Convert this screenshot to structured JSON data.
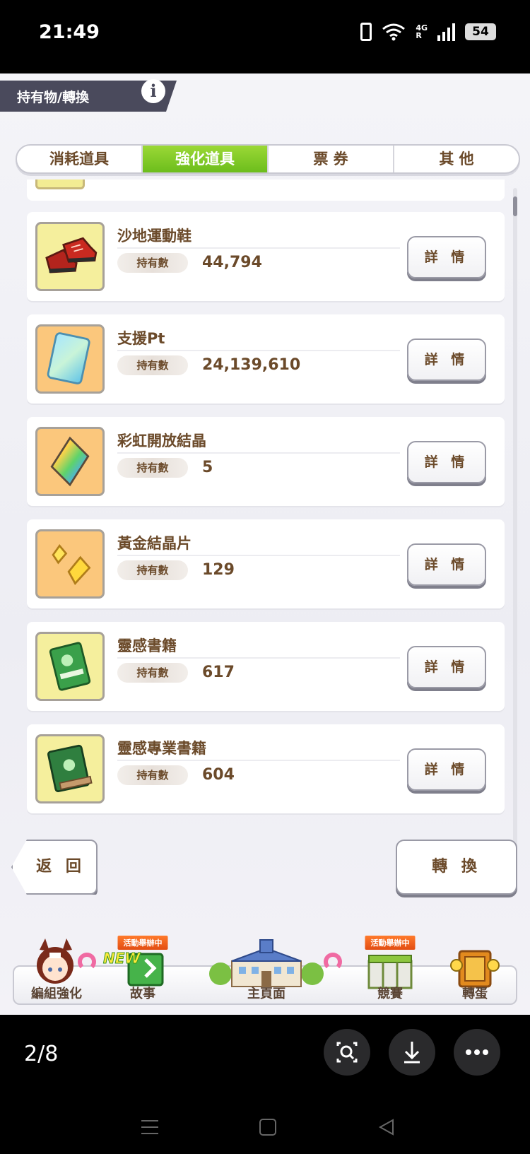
{
  "status_bar": {
    "time": "21:49",
    "network": "4G",
    "roaming": "R",
    "battery": "54"
  },
  "header": {
    "title": "持有物/轉換",
    "info_icon": "i"
  },
  "tabs": [
    {
      "label": "消耗道具",
      "active": false
    },
    {
      "label": "強化道具",
      "active": true
    },
    {
      "label": "票 券",
      "active": false
    },
    {
      "label": "其 他",
      "active": false
    }
  ],
  "items": [
    {
      "name": "沙地運動鞋",
      "hold_label": "持有數",
      "count": "44,794",
      "detail_label": "詳 情",
      "icon": "sneakers-icon"
    },
    {
      "name": "支援Pt",
      "hold_label": "持有數",
      "count": "24,139,610",
      "detail_label": "詳 情",
      "icon": "support-pt-card-icon"
    },
    {
      "name": "彩虹開放結晶",
      "hold_label": "持有數",
      "count": "5",
      "detail_label": "詳 情",
      "icon": "rainbow-crystal-icon"
    },
    {
      "name": "黃金結晶片",
      "hold_label": "持有數",
      "count": "129",
      "detail_label": "詳 情",
      "icon": "gold-crystal-shard-icon"
    },
    {
      "name": "靈感書籍",
      "hold_label": "持有數",
      "count": "617",
      "detail_label": "詳 情",
      "icon": "inspiration-book-icon"
    },
    {
      "name": "靈感專業書籍",
      "hold_label": "持有數",
      "count": "604",
      "detail_label": "詳 情",
      "icon": "pro-inspiration-book-icon"
    }
  ],
  "actions": {
    "back_label": "返 回",
    "convert_label": "轉 換"
  },
  "bottom_nav": {
    "items": [
      {
        "label": "編組強化"
      },
      {
        "label": "故事",
        "tag": "活動舉辦中",
        "new": "NEW"
      },
      {
        "label": "主頁面"
      },
      {
        "label": "競賽",
        "tag": "活動舉辦中"
      },
      {
        "label": "轉蛋"
      }
    ]
  },
  "gallery": {
    "page_counter": "2/8"
  }
}
